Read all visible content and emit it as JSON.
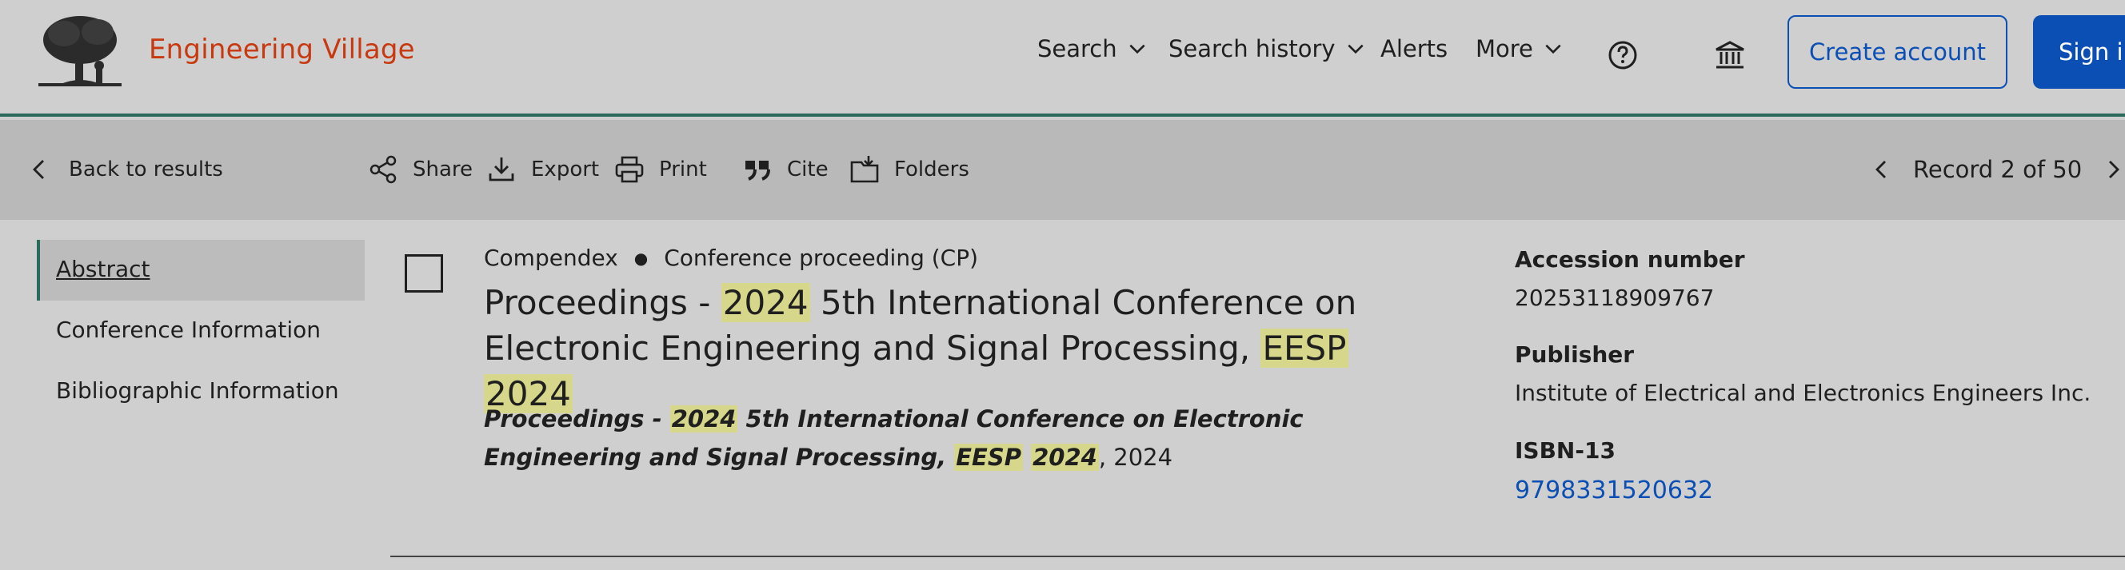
{
  "header": {
    "brand": "Engineering Village",
    "nav": {
      "search": "Search",
      "search_history": "Search history",
      "alerts": "Alerts",
      "more": "More"
    },
    "help_icon": "help-circle-icon",
    "institution_icon": "institution-icon",
    "create_account": "Create account",
    "sign_in": "Sign in",
    "colors": {
      "brand": "#c8390f",
      "primary": "#0b4fb5",
      "accent": "#2a6b5c"
    }
  },
  "toolbar": {
    "back": "Back to results",
    "share": "Share",
    "export": "Export",
    "print": "Print",
    "cite": "Cite",
    "folders": "Folders",
    "record": "Record 2 of 50"
  },
  "sidebar": {
    "items": [
      {
        "label": "Abstract",
        "active": true
      },
      {
        "label": "Conference Information",
        "active": false
      },
      {
        "label": "Bibliographic Information",
        "active": false
      }
    ]
  },
  "record": {
    "database": "Compendex",
    "doc_type": "Conference proceeding (CP)",
    "title": {
      "p1": "Proceedings - ",
      "h1": "2024",
      "p2": " 5th International Conference on Electronic Engineering and Signal Processing, ",
      "h2": "EESP",
      "p3": " ",
      "h3": "2024"
    },
    "source": {
      "p1": "Proceedings - ",
      "h1": "2024",
      "p2": " 5th International Conference on Electronic Engineering and Signal Processing, ",
      "h2": "EESP",
      "p3": " ",
      "h3": "2024",
      "tail": ", 2024"
    }
  },
  "details": {
    "accession_label": "Accession number",
    "accession_value": "20253118909767",
    "publisher_label": "Publisher",
    "publisher_value": "Institute of Electrical and Electronics Engineers Inc.",
    "isbn_label": "ISBN-13",
    "isbn_value": "9798331520632"
  }
}
